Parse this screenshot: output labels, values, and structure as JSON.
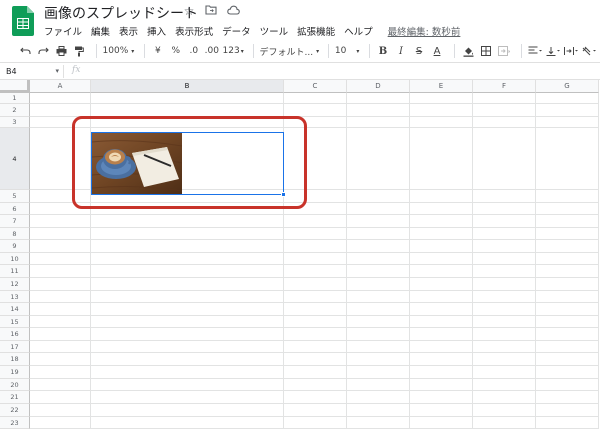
{
  "app": {
    "doc_title": "画像のスプレッドシート",
    "title_icons": [
      "star-icon",
      "folder-move-icon",
      "cloud-status-icon"
    ],
    "logo_color": "#0f9d58"
  },
  "menu": {
    "items": [
      "ファイル",
      "編集",
      "表示",
      "挿入",
      "表示形式",
      "データ",
      "ツール",
      "拡張機能",
      "ヘルプ"
    ],
    "last_edit": "最終編集: 数秒前"
  },
  "toolbar": {
    "zoom": "100%",
    "currency": "¥",
    "percent": "%",
    "decimal_decrease": ".0",
    "decimal_increase": ".00",
    "number_format": "123",
    "font_family": "デフォルト...",
    "font_size": "10",
    "bold": "B",
    "italic": "I",
    "strikethrough": "S",
    "text_color": "A"
  },
  "formula_bar": {
    "cell_ref": "B4",
    "fx": "fx",
    "value": ""
  },
  "grid": {
    "columns": [
      "A",
      "B",
      "C",
      "D",
      "E",
      "F",
      "G"
    ],
    "rows": [
      "1",
      "2",
      "3",
      "4",
      "5",
      "6",
      "7",
      "8",
      "9",
      "10",
      "11",
      "12",
      "13",
      "14",
      "15",
      "16",
      "17",
      "18",
      "19",
      "20",
      "21",
      "22",
      "23"
    ],
    "selected_cell": "B4",
    "image_cell": "B4",
    "image_description": "coffee-cup-and-notebook-photo",
    "highlight_color": "#c8332a"
  }
}
